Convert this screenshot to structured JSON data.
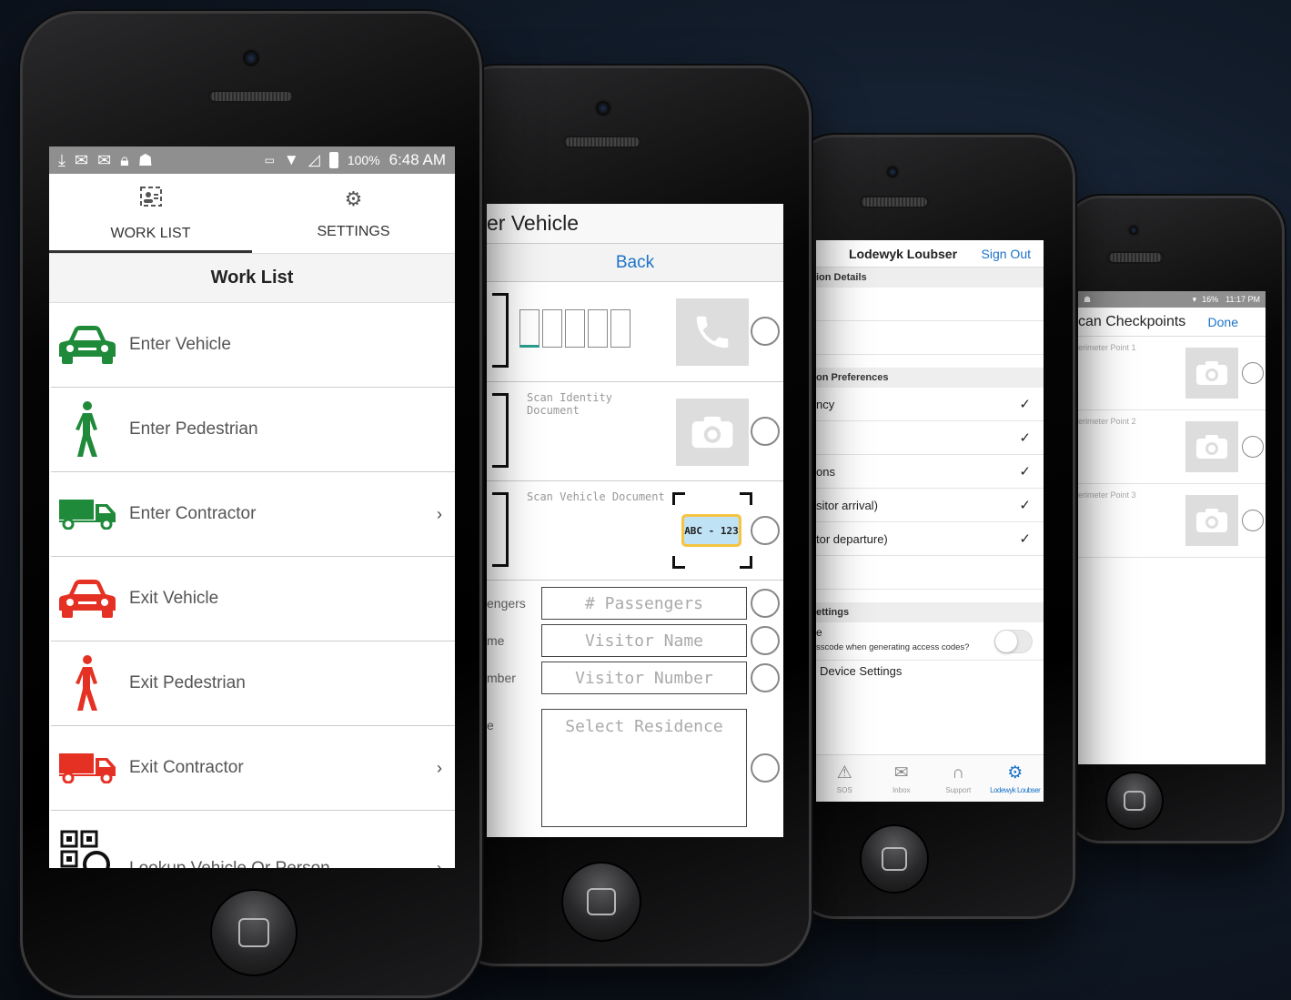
{
  "phone1": {
    "status": {
      "battery": "100%",
      "time": "6:48 AM"
    },
    "tabs": [
      {
        "label": "WORK LIST",
        "icon": "id-card-icon"
      },
      {
        "label": "SETTINGS",
        "icon": "gear-icon"
      }
    ],
    "header": "Work List",
    "items": [
      {
        "label": "Enter Vehicle",
        "icon": "car-icon",
        "color": "#1f8a3a",
        "chevron": ""
      },
      {
        "label": "Enter Pedestrian",
        "icon": "pedestrian-icon",
        "color": "#1f8a3a",
        "chevron": ""
      },
      {
        "label": "Enter Contractor",
        "icon": "truck-icon",
        "color": "#1f8a3a",
        "chevron": "›"
      },
      {
        "label": "Exit Vehicle",
        "icon": "car-icon",
        "color": "#e53124",
        "chevron": ""
      },
      {
        "label": "Exit Pedestrian",
        "icon": "pedestrian-icon",
        "color": "#e53124",
        "chevron": ""
      },
      {
        "label": "Exit Contractor",
        "icon": "truck-icon",
        "color": "#e53124",
        "chevron": "›"
      },
      {
        "label": "Lookup Vehicle Or Person",
        "icon": "qr-lookup-icon",
        "color": "#111111",
        "chevron": "›"
      }
    ]
  },
  "phone2": {
    "title": "er Vehicle",
    "back": "Back",
    "scan_identity": "Scan Identity\nDocument",
    "scan_vehicle": "Scan Vehicle Document",
    "plate_text": "ABC - 123",
    "fields": [
      {
        "label": "engers",
        "placeholder": "# Passengers"
      },
      {
        "label": "me",
        "placeholder": "Visitor Name"
      },
      {
        "label": "mber",
        "placeholder": "Visitor Number"
      }
    ],
    "residence_label": "e",
    "residence": "Select Residence"
  },
  "phone3": {
    "user": "Lodewyk Loubser",
    "signout": "Sign Out",
    "sec1": "ion Details",
    "sec2": "on Preferences",
    "prefs": [
      "ncy",
      "",
      "ons",
      "sitor arrival)",
      "tor departure)"
    ],
    "check": "✓",
    "sec3": "ettings",
    "setting_line1": "e",
    "setting_line2": "sscode when generating access codes?",
    "device_settings": "Device Settings",
    "tabs": [
      {
        "label": "SOS",
        "icon": "warning-icon"
      },
      {
        "label": "Inbox",
        "icon": "mail-icon"
      },
      {
        "label": "Support",
        "icon": "headset-icon"
      },
      {
        "label": "Lodewyk Loubser",
        "icon": "gear-icon"
      }
    ],
    "accent": "#1c73c9"
  },
  "phone4": {
    "status": {
      "battery": "16%",
      "time": "11:17 PM"
    },
    "title": "can Checkpoints",
    "done": "Done",
    "checkpoints": [
      "erimeter Point 1",
      "erimeter Point 2",
      "erimeter Point 3"
    ]
  }
}
